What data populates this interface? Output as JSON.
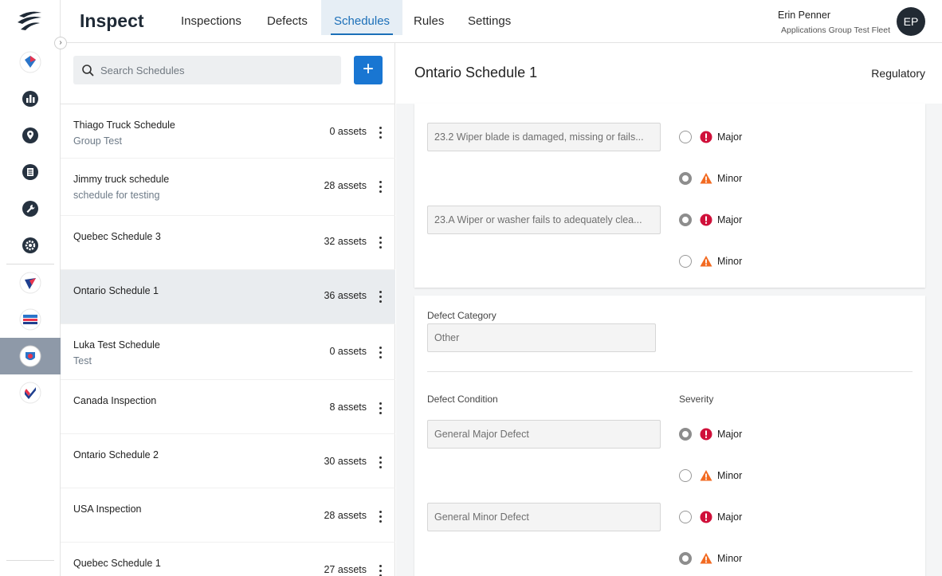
{
  "app": {
    "brand": "Inspect"
  },
  "nav": {
    "tabs": [
      {
        "label": "Inspections"
      },
      {
        "label": "Defects"
      },
      {
        "label": "Schedules"
      },
      {
        "label": "Rules"
      },
      {
        "label": "Settings"
      }
    ],
    "active_tab": "Schedules"
  },
  "user": {
    "name": "Erin Penner",
    "fleet": "Applications Group Test Fleet",
    "initials": "EP"
  },
  "sidebar": {
    "icons": [
      "logo-icon",
      "fleet-icon",
      "reports-icon",
      "location-icon",
      "documents-icon",
      "maintenance-icon",
      "settings-icon",
      "app-1-icon",
      "app-2-icon",
      "inspect-app-icon",
      "app-4-icon"
    ],
    "active": "inspect-app-icon",
    "toggle_glyph": "›"
  },
  "search": {
    "placeholder": "Search Schedules",
    "value": ""
  },
  "add_button": {
    "glyph": "+"
  },
  "schedules": [
    {
      "name": "Thiago Truck Schedule",
      "sub": "Group Test",
      "assets": "0 assets"
    },
    {
      "name": "Jimmy truck schedule",
      "sub": "schedule for testing",
      "assets": "28 assets"
    },
    {
      "name": "Quebec Schedule 3",
      "sub": "",
      "assets": "32 assets"
    },
    {
      "name": "Ontario Schedule 1",
      "sub": "",
      "assets": "36 assets"
    },
    {
      "name": "Luka Test Schedule",
      "sub": "Test",
      "assets": "0 assets"
    },
    {
      "name": "Canada Inspection",
      "sub": "",
      "assets": "8 assets"
    },
    {
      "name": "Ontario Schedule 2",
      "sub": "",
      "assets": "30 assets"
    },
    {
      "name": "USA Inspection",
      "sub": "",
      "assets": "28 assets"
    },
    {
      "name": "Quebec Schedule 1",
      "sub": "",
      "assets": "27 assets"
    }
  ],
  "selected_schedule": "Ontario Schedule 1",
  "detail": {
    "title": "Ontario Schedule 1",
    "type": "Regulatory",
    "card1": {
      "conditions": [
        {
          "text": "23.2 Wiper blade is damaged, missing or fails...",
          "major_checked": false,
          "minor_checked": true
        },
        {
          "text": "23.A Wiper or washer fails to adequately clea...",
          "major_checked": true,
          "minor_checked": false
        }
      ]
    },
    "card2": {
      "category_label": "Defect Category",
      "category_value": "Other",
      "condition_label": "Defect Condition",
      "severity_label": "Severity",
      "conditions": [
        {
          "text": "General Major Defect",
          "major_checked": true,
          "minor_checked": false
        },
        {
          "text": "General Minor Defect",
          "major_checked": false,
          "minor_checked": true
        }
      ]
    },
    "severity": {
      "major": "Major",
      "minor": "Minor"
    }
  },
  "colors": {
    "accent": "#1b6fb8",
    "add_button": "#1976d2",
    "major": "#d0103a",
    "minor": "#f26a21",
    "selected_row": "#e9ecef"
  }
}
